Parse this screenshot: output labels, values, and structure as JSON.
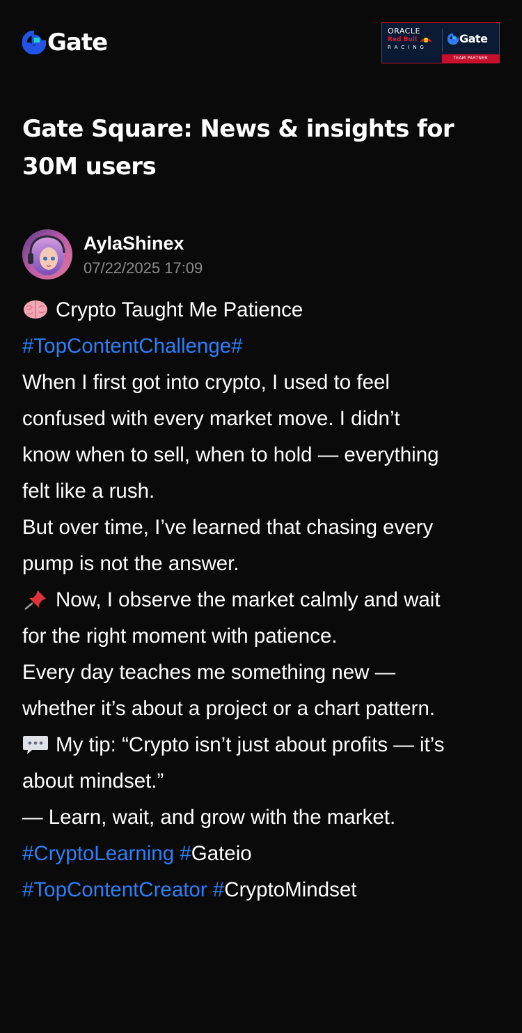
{
  "header": {
    "logo_text": "Gate",
    "partner_badge": {
      "line1": "ORACLE",
      "line2": "Red Bull",
      "line3": "RACING",
      "brand": "Gate",
      "caption": "TEAM PARTNER"
    }
  },
  "page_title": "Gate Square: News & insights for 30M users",
  "post": {
    "author": {
      "name": "AylaShinex",
      "timestamp": "07/22/2025 17:09"
    },
    "lines": [
      "Crypto Taught Me Patience",
      "#TopContentChallenge#",
      "When I first got into crypto, I used to feel",
      "confused with every market move. I didn’t",
      "know when to sell, when to hold — everything",
      "felt like a rush.",
      "But over time, I’ve learned that chasing every",
      "pump is not the answer.",
      "Now, I observe the market calmly and wait",
      "for the right moment with patience.",
      "Every day teaches me something new —",
      "whether it’s about a project or a chart pattern.",
      "My tip: “Crypto isn’t just about profits — it’s",
      "about mindset.”",
      "— Learn, wait, and grow with the market."
    ],
    "hashtags_line1": {
      "tag1": "#CryptoLearning",
      "tag2_hash": "#",
      "tag2_word": "Gateio"
    },
    "hashtags_line2": {
      "tag1": "#TopContentCreator",
      "tag2_hash": "#",
      "tag2_word": "CryptoMindset"
    },
    "emojis": [
      "brain-icon",
      "pushpin-icon",
      "speech-balloon-icon"
    ]
  },
  "colors": {
    "background": "#0a0a0a",
    "text": "#ffffff",
    "muted": "#8a8a8a",
    "hashtag": "#2d7ff9",
    "brand_blue": "#2354e6",
    "partner_red": "#c8102e"
  }
}
